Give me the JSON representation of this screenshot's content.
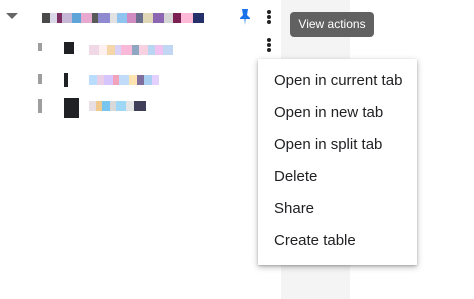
{
  "tooltip": {
    "label": "View actions"
  },
  "context_menu": {
    "items": [
      {
        "label": "Open in current tab"
      },
      {
        "label": "Open in new tab"
      },
      {
        "label": "Open in split tab"
      },
      {
        "label": "Delete"
      },
      {
        "label": "Share"
      },
      {
        "label": "Create table"
      }
    ]
  },
  "icons": {
    "expand": "triangle-down-icon",
    "pin": "pin-icon",
    "more": "more-vertical-icon"
  },
  "colors": {
    "pin": "#1a73e8",
    "tooltip_bg": "#616161",
    "menu_text": "#202124",
    "lane_bg": "#f4f4f4"
  }
}
